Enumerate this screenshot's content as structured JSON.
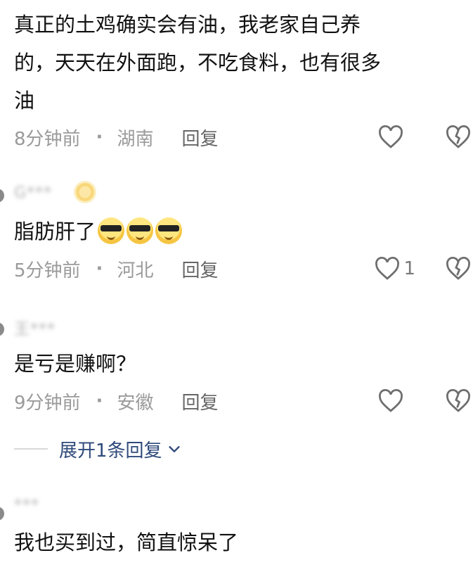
{
  "comments": [
    {
      "content_lines": [
        "真正的土鸡确实会有油，我老家自己养",
        "的，天天在外面跑，不吃食料，也有很多",
        "油"
      ],
      "time": "8分钟前",
      "location": "湖南",
      "reply_label": "回复",
      "like_count": ""
    },
    {
      "username": "G***",
      "content": "脂肪肝了",
      "emoji_names": [
        "cool-sunglasses-emoji",
        "cool-sunglasses-emoji",
        "cool-sunglasses-emoji"
      ],
      "time": "5分钟前",
      "location": "河北",
      "reply_label": "回复",
      "like_count": "1"
    },
    {
      "username": "王***",
      "content": "是亏是赚啊？",
      "time": "9分钟前",
      "location": "安徽",
      "reply_label": "回复",
      "like_count": "",
      "expand_label": "展开1条回复"
    },
    {
      "username": "***",
      "content": "我也买到过，简直惊呆了"
    }
  ],
  "icons": {
    "like": "heart-outline-icon",
    "dislike": "broken-heart-icon",
    "expand": "chevron-down-icon"
  },
  "colors": {
    "text": "#111111",
    "meta": "#9a9a9a",
    "expand_link": "#2f4a7a"
  }
}
